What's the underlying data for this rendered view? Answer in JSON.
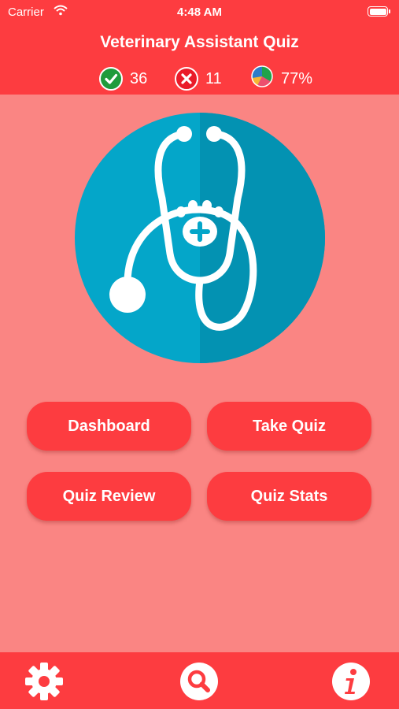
{
  "status_bar": {
    "carrier": "Carrier",
    "time": "4:48 AM"
  },
  "header": {
    "title": "Veterinary Assistant Quiz",
    "stats": {
      "correct": "36",
      "wrong": "11",
      "score": "77%"
    }
  },
  "buttons": {
    "dashboard": "Dashboard",
    "take_quiz": "Take Quiz",
    "quiz_review": "Quiz Review",
    "quiz_stats": "Quiz Stats"
  },
  "footer": {
    "icons": [
      "gear-icon",
      "search-icon",
      "info-icon"
    ]
  },
  "colors": {
    "header": "#fd3c40",
    "background": "#fa8583",
    "logo_circle": "#04a6c9",
    "correct": "#1f9b3c",
    "wrong": "#ea1c2a"
  }
}
